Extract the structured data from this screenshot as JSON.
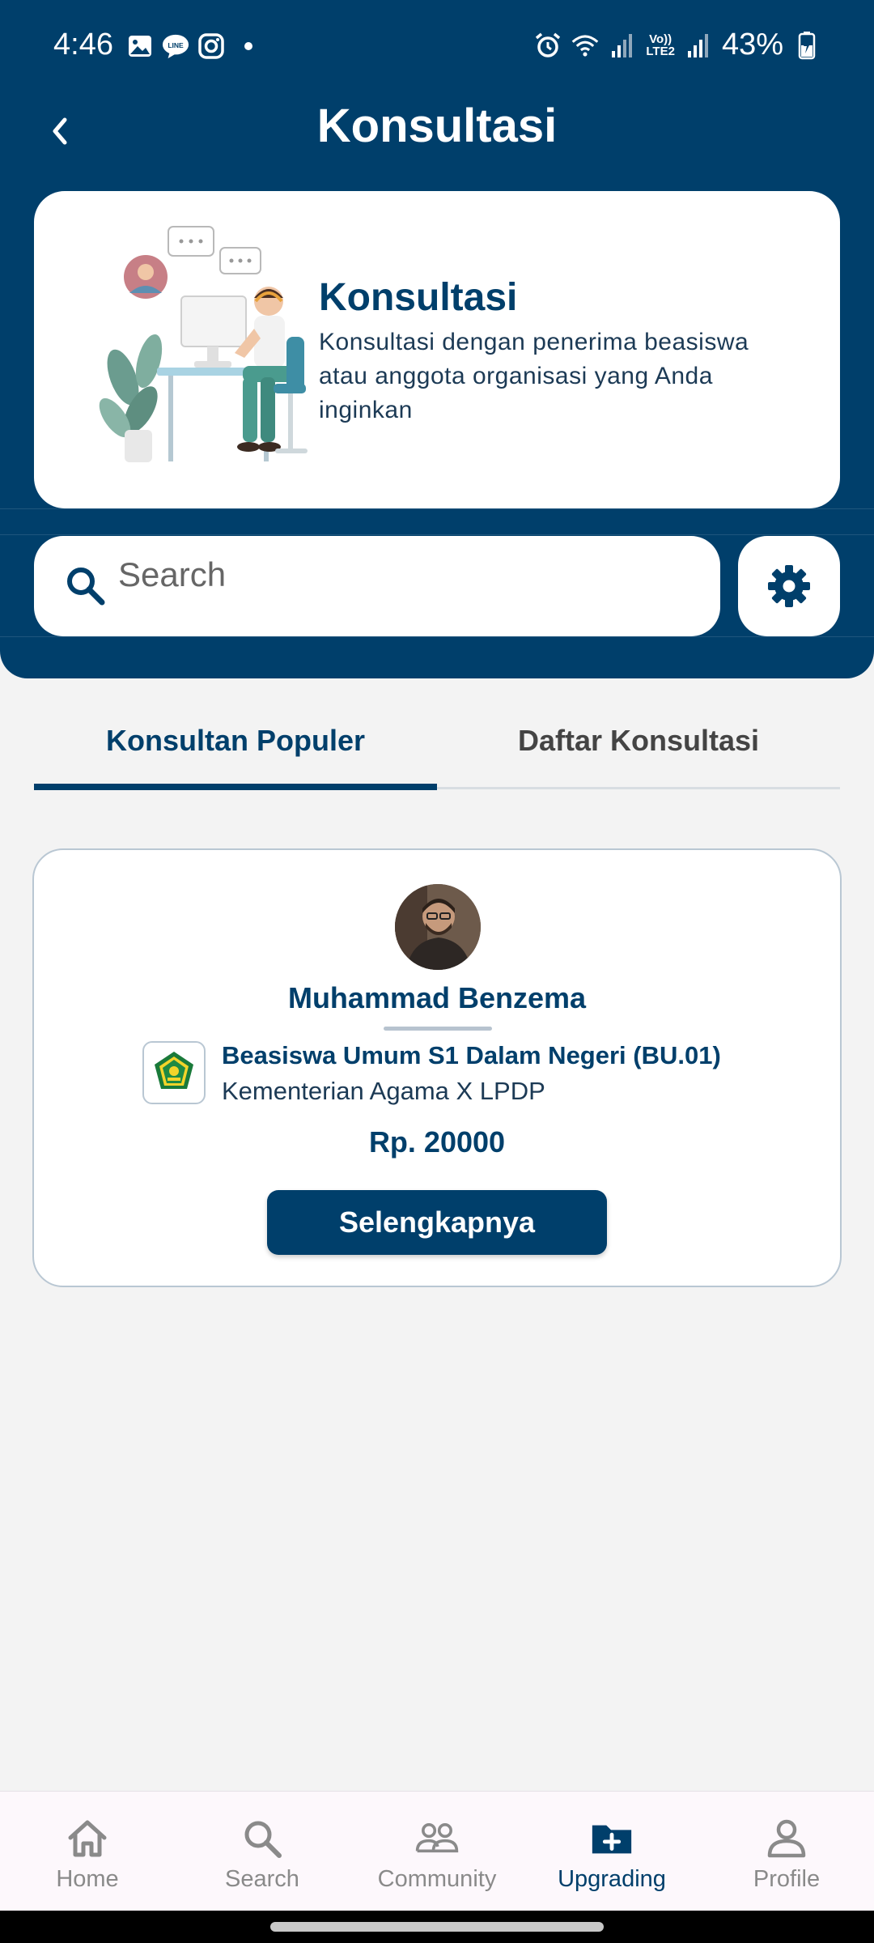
{
  "status_bar": {
    "time": "4:46",
    "battery": "43%",
    "network_label_top": "Vo))",
    "network_label_bottom": "LTE2",
    "left_icons": [
      "gallery-icon",
      "line-icon",
      "instagram-icon"
    ],
    "right_icons": [
      "alarm-icon",
      "wifi-icon",
      "signal-icon",
      "signal-icon",
      "battery-charging-icon"
    ]
  },
  "topbar": {
    "title": "Konsultasi",
    "back_icon": "chevron-left-icon"
  },
  "hero": {
    "title": "Konsultasi",
    "description": "Konsultasi dengan penerima beasiswa atau anggota organisasi yang Anda inginkan"
  },
  "search": {
    "placeholder": "Search",
    "value": ""
  },
  "tabs": [
    {
      "label": "Konsultan Populer",
      "active": true
    },
    {
      "label": "Daftar Konsultasi",
      "active": false
    }
  ],
  "consultant": {
    "name": "Muhammad Benzema",
    "scholarship": "Beasiswa Umum S1 Dalam Negeri (BU.01)",
    "organization": "Kementerian Agama X LPDP",
    "price": "Rp. 20000",
    "button_label": "Selengkapnya"
  },
  "bottom_nav": [
    {
      "label": "Home",
      "icon": "home-icon",
      "active": false
    },
    {
      "label": "Search",
      "icon": "search-icon",
      "active": false
    },
    {
      "label": "Community",
      "icon": "community-icon",
      "active": false
    },
    {
      "label": "Upgrading",
      "icon": "folder-plus-icon",
      "active": true
    },
    {
      "label": "Profile",
      "icon": "profile-icon",
      "active": false
    }
  ],
  "colors": {
    "primary": "#003f6b",
    "background": "#f3f3f3",
    "nav_inactive": "#8a8a8a"
  }
}
